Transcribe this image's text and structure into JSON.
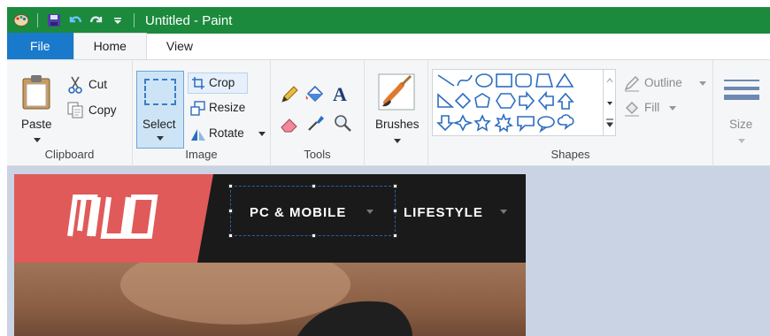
{
  "window": {
    "title": "Untitled - Paint",
    "accent": "#1b8a3d"
  },
  "menu_tabs": [
    {
      "label": "File"
    },
    {
      "label": "Home"
    },
    {
      "label": "View"
    }
  ],
  "clipboard": {
    "paste": "Paste",
    "cut": "Cut",
    "copy": "Copy",
    "group": "Clipboard"
  },
  "image": {
    "select": "Select",
    "crop": "Crop",
    "resize": "Resize",
    "rotate": "Rotate",
    "group": "Image"
  },
  "tools": {
    "group": "Tools",
    "text_glyph": "A"
  },
  "brushes": {
    "label": "Brushes"
  },
  "shapes": {
    "outline": "Outline",
    "fill": "Fill",
    "group": "Shapes"
  },
  "size": {
    "label": "Size"
  },
  "canvas_image": {
    "nav_item_1": "PC & MOBILE",
    "nav_item_2": "LIFESTYLE",
    "brand_color": "#e05a5a"
  }
}
